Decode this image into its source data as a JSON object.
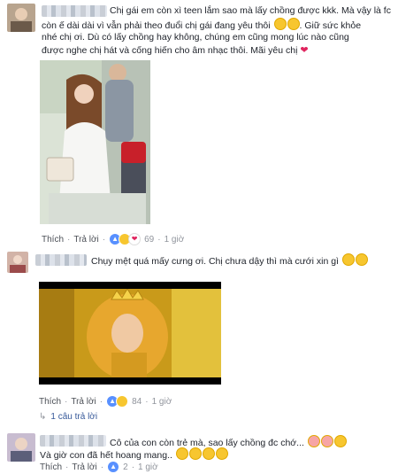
{
  "comments": [
    {
      "text_line1": "Chị gái em còn xì teen lắm sao mà lấy chồng được kkk. Mà vậy là fc",
      "text_line2": "còn ế dài dài vì vẫn phải theo đuổi chị gái đang yêu thôi",
      "text_line3": ". Giữ sức khỏe",
      "text_line4": "nhé chị ơi. Dù có lấy chồng hay không, chúng em cũng mong lúc nào cũng",
      "text_line5": "được nghe chị hát và cống hiến cho âm nhạc thôi. Mãi yêu chị",
      "like_label": "Thích",
      "reply_label": "Trả lời",
      "reaction_count": "69",
      "time": "1 giờ"
    },
    {
      "text": "Chụy mệt quá mấy cưng ơi. Chị chưa dậy thì mà cưới xin gì",
      "like_label": "Thích",
      "reply_label": "Trả lời",
      "reaction_count": "84",
      "time": "1 giờ",
      "replies_link": "1 câu trả lời"
    },
    {
      "text_line1": "Cô của con còn trẻ mà, sao lấy chồng đc chớ...",
      "text_line2": "Và giờ con đã hết hoang mang..",
      "like_label": "Thích",
      "reply_label": "Trả lời",
      "reaction_count": "2",
      "time": "1 giờ"
    }
  ],
  "separator": "·",
  "icons": [
    "laugh-emoji-icon",
    "heart-icon",
    "like-reaction-icon",
    "wow-reaction-icon",
    "reply-arrow-icon"
  ],
  "colors": {
    "link": "#4b4f56",
    "meta": "#90949c",
    "like_blue": "#5890ff",
    "haha_yellow": "#f7c62f",
    "heart_red": "#e0245e"
  }
}
